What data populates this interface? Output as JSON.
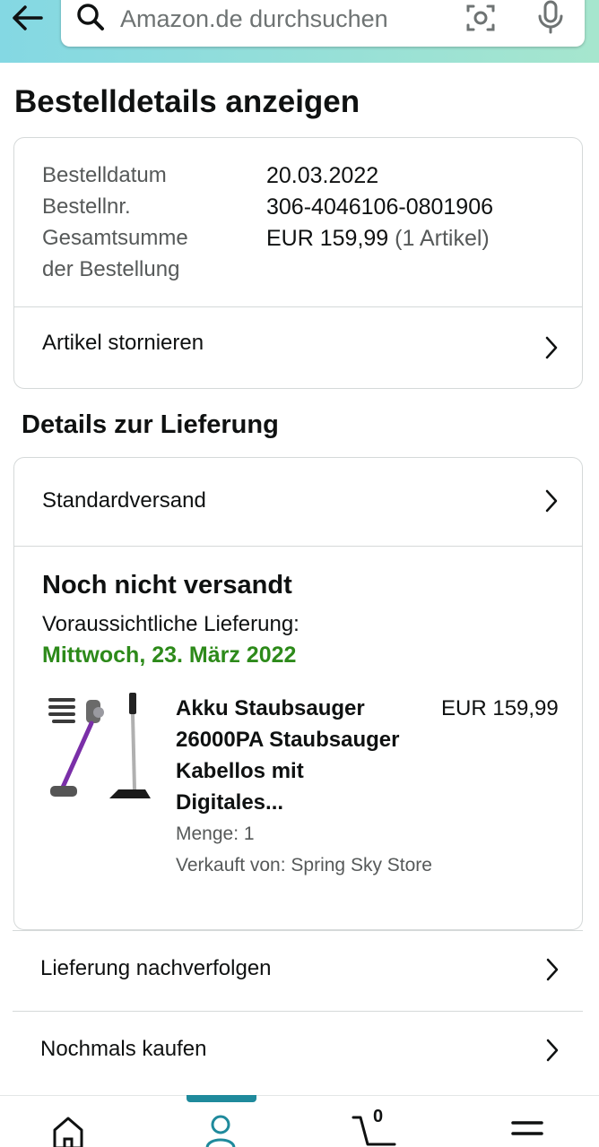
{
  "search": {
    "placeholder": "Amazon.de durchsuchen"
  },
  "page_title": "Bestelldetails anzeigen",
  "order": {
    "date_label": "Bestelldatum",
    "date_value": "20.03.2022",
    "number_label": "Bestellnr.",
    "number_value": "306-4046106-0801906",
    "total_label_line1": "Gesamtsumme",
    "total_label_line2": "der Bestellung",
    "total_value": "EUR 159,99",
    "total_items": "(1 Artikel)",
    "cancel_label": "Artikel stornieren"
  },
  "delivery": {
    "section_title": "Details zur Lieferung",
    "shipping_method": "Standardversand",
    "status": "Noch nicht versandt",
    "eta_label": "Voraussichtliche Lieferung:",
    "eta_date": "Mittwoch, 23. März 2022",
    "product": {
      "title_lines": [
        "Akku Staubsauger",
        "26000PA Staubsauger",
        "Kabellos mit",
        "Digitales..."
      ],
      "price": "EUR 159,99",
      "quantity": "Menge: 1",
      "seller": "Verkauft von: Spring Sky Store"
    }
  },
  "actions": {
    "track": "Lieferung nachverfolgen",
    "buy_again": "Nochmals kaufen"
  },
  "nav": {
    "cart_count": "0"
  },
  "colors": {
    "accent": "#1f8a9c",
    "eta_green": "#2d8a1a",
    "header_start": "#84d8e3",
    "header_end": "#a6e6ce"
  }
}
